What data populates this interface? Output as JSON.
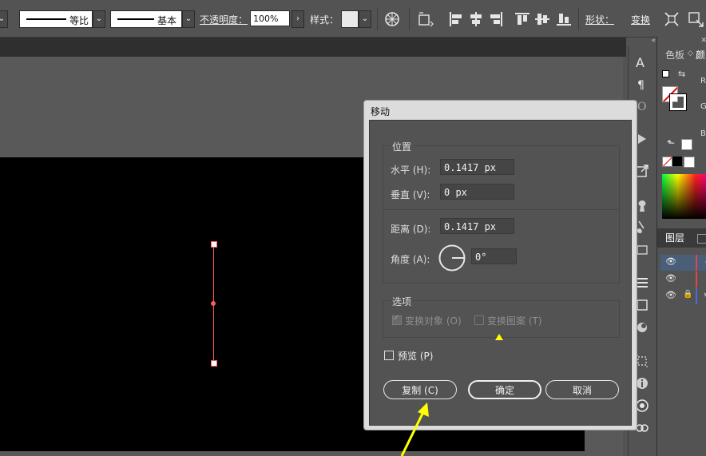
{
  "control_bar": {
    "stroke_profile_label": "等比",
    "brush_label": "基本",
    "opacity_label": "不透明度：",
    "opacity_value": "100%",
    "style_label": "样式：",
    "shape_label": "形状：",
    "transform_label": "变换"
  },
  "panels": {
    "swatches_tab": "色板",
    "color_tab": "颜",
    "channels": [
      "R",
      "G",
      "B"
    ],
    "layers_tab": "图层"
  },
  "dialog": {
    "title": "移动",
    "position_group": "位置",
    "horizontal_label": "水平 (H):",
    "horizontal_value": "0.1417 px",
    "vertical_label": "垂直 (V):",
    "vertical_value": "0 px",
    "distance_label": "距离 (D):",
    "distance_value": "0.1417 px",
    "angle_label": "角度 (A):",
    "angle_value": "0°",
    "options_group": "选项",
    "transform_objects_label": "变换对象 (O)",
    "transform_pattern_label": "变换图案 (T)",
    "preview_label": "预览 (P)",
    "copy_button": "复制 (C)",
    "ok_button": "确定",
    "cancel_button": "取消"
  },
  "colors": {
    "accent_annotation": "#ffff00",
    "selection": "#ff4d4d",
    "dialog_bg": "#535353"
  }
}
